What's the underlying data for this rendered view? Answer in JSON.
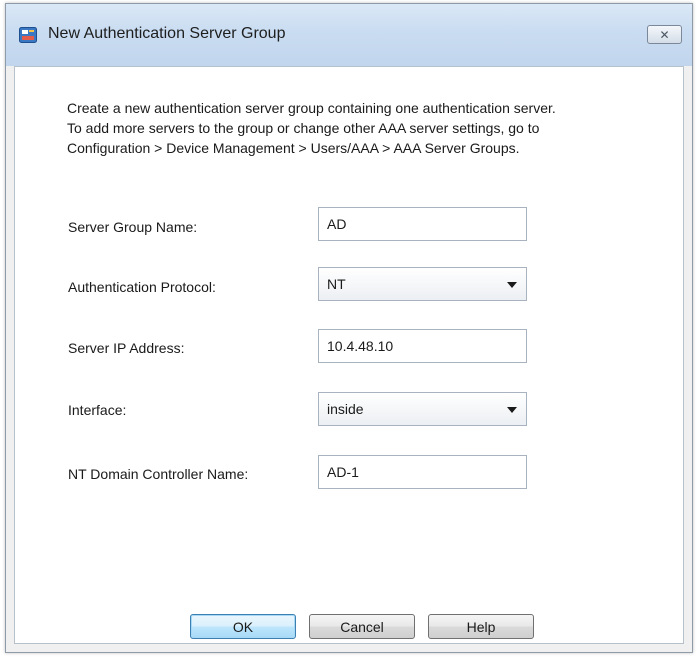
{
  "window": {
    "title": "New Authentication Server Group",
    "close_icon": "close-icon"
  },
  "description": {
    "line1": "Create a new authentication server group containing one authentication server.",
    "line2": "To add more servers to the group or change other AAA server settings, go to",
    "line3": "Configuration > Device Management > Users/AAA > AAA Server Groups."
  },
  "form": {
    "server_group_name": {
      "label": "Server Group Name:",
      "value": "AD"
    },
    "auth_protocol": {
      "label": "Authentication Protocol:",
      "value": "NT"
    },
    "server_ip": {
      "label": "Server IP Address:",
      "value": "10.4.48.10"
    },
    "interface": {
      "label": "Interface:",
      "value": "inside"
    },
    "nt_domain_controller": {
      "label": "NT Domain Controller Name:",
      "value": "AD-1"
    }
  },
  "buttons": {
    "ok": "OK",
    "cancel": "Cancel",
    "help": "Help"
  }
}
